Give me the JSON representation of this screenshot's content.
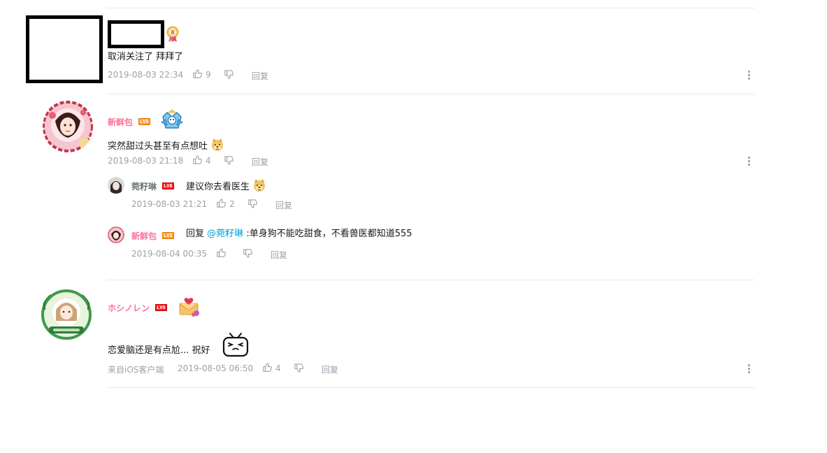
{
  "comments": [
    {
      "text": "取消关注了 拜拜了",
      "time": "2019-08-03 22:34",
      "likes": "9",
      "reply_label": "回复"
    },
    {
      "username": "新鲜包",
      "level": "LV5",
      "text": "突然甜过头甚至有点想吐",
      "time": "2019-08-03 21:18",
      "likes": "4",
      "reply_label": "回复",
      "replies": [
        {
          "username": "菀籽琳",
          "level": "LV6",
          "text": "建议你去看医生",
          "time": "2019-08-03 21:21",
          "likes": "2",
          "reply_label": "回复"
        },
        {
          "username": "新鲜包",
          "level": "LV5",
          "prefix": "回复",
          "mention": "@菀籽琳",
          "text": ":单身狗不能吃甜食，不看兽医都知道555",
          "time": "2019-08-04 00:35",
          "reply_label": "回复"
        }
      ]
    },
    {
      "username": "ホシノレン",
      "level": "LV6",
      "text": "恋爱脑还是有点尬... 祝好",
      "source": "来自iOS客户端",
      "time": "2019-08-05 06:50",
      "likes": "4",
      "reply_label": "回复"
    }
  ],
  "colors": {
    "username": "#fb7299",
    "meta": "#99a2aa",
    "mention": "#00a1d6",
    "divider": "#e5e9ef"
  }
}
